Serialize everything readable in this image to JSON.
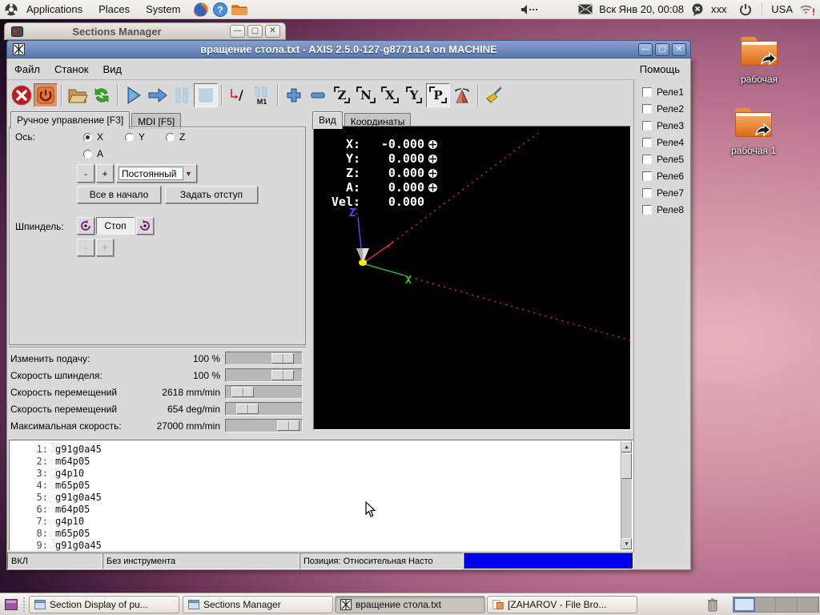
{
  "panel": {
    "menus": {
      "applications": "Applications",
      "places": "Places",
      "system": "System"
    },
    "clock": "Вск Янв 20, 00:08",
    "im_label": "xxx",
    "keyboard": "USA",
    "volume_dashes": "---"
  },
  "sections_window": {
    "title": "Sections Manager"
  },
  "axis_window": {
    "title": "вращение стола.txt - AXIS 2.5.0-127-g8771a14 on MACHINE",
    "menu": {
      "file": "Файл",
      "machine": "Станок",
      "view": "Вид",
      "help": "Помощь"
    },
    "toolbar": {
      "m1": "M1",
      "letters": [
        "Z",
        "N",
        "X",
        "Y",
        "P"
      ]
    },
    "tabs_left": [
      "Ручное управление [F3]",
      "MDI [F5]"
    ],
    "tabs_view": [
      "Вид",
      "Координаты"
    ],
    "manual": {
      "axis_label": "Ось:",
      "axes": [
        "X",
        "Y",
        "Z",
        "A"
      ],
      "minus": "-",
      "plus": "+",
      "jog_mode": "Постоянный",
      "home_all": "Все в начало",
      "touch_off": "Задать отступ",
      "spindle_label": "Шпиндель:",
      "spindle_stop": "Стоп",
      "sp_minus": "-",
      "sp_plus": "+"
    },
    "sliders": [
      {
        "label": "Изменить подачу:",
        "value": "100 %"
      },
      {
        "label": "Скорость шпинделя:",
        "value": "100 %"
      },
      {
        "label": "Скорость перемещений",
        "value": "2618 mm/min"
      },
      {
        "label": "Скорость перемещений",
        "value": "654 deg/min"
      },
      {
        "label": "Максимальная скорость:",
        "value": "27000 mm/min"
      }
    ],
    "dro": [
      {
        "label": "X:",
        "value": "-0.000"
      },
      {
        "label": "Y:",
        "value": "0.000"
      },
      {
        "label": "Z:",
        "value": "0.000"
      },
      {
        "label": "A:",
        "value": "0.000"
      },
      {
        "label": "Vel:",
        "value": "0.000"
      }
    ],
    "relays": [
      "Реле1",
      "Реле2",
      "Реле3",
      "Реле4",
      "Реле5",
      "Реле6",
      "Реле7",
      "Реле8"
    ],
    "gcode": [
      {
        "n": "1:",
        "code": "g91g0a45"
      },
      {
        "n": "2:",
        "code": "m64p05"
      },
      {
        "n": "3:",
        "code": "g4p10"
      },
      {
        "n": "4:",
        "code": "m65p05"
      },
      {
        "n": "5:",
        "code": "g91g0a45"
      },
      {
        "n": "6:",
        "code": "m64p05"
      },
      {
        "n": "7:",
        "code": "g4p10"
      },
      {
        "n": "8:",
        "code": "m65p05"
      },
      {
        "n": "9:",
        "code": "g91g0a45"
      }
    ],
    "status": {
      "on": "ВКЛ",
      "tool": "Без инструмента",
      "position": "Позиция: Относительная Насто"
    }
  },
  "desktop": {
    "icons": [
      {
        "label": "рабочая"
      },
      {
        "label": "рабочая 1"
      }
    ]
  },
  "taskbar": {
    "items": [
      {
        "label": "Section Display of pu..."
      },
      {
        "label": "Sections Manager"
      },
      {
        "label": "вращение стола.txt"
      },
      {
        "label": "[ZAHAROV - File Bro..."
      }
    ]
  },
  "colors": {
    "titlebar_blue": "#6d8ec0",
    "status_blue": "#0000ee",
    "canvas_bg": "#000000"
  }
}
